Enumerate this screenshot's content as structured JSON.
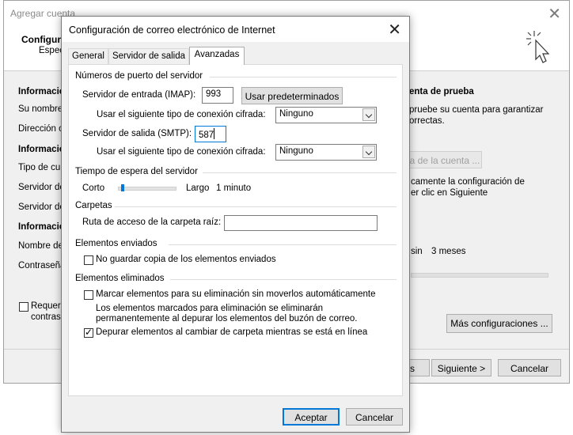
{
  "background_window": {
    "title": "Agregar cuenta",
    "header_title": "Configura",
    "header_subtitle": "Espec",
    "left_labels": [
      {
        "text": "Informació",
        "bold": true
      },
      {
        "text": "Su nombre",
        "bold": false
      },
      {
        "text": "Dirección c",
        "bold": false
      },
      {
        "text": "Informació",
        "bold": true
      },
      {
        "text": "Tipo de cu",
        "bold": false
      },
      {
        "text": "Servidor de",
        "bold": false
      },
      {
        "text": "Servidor de",
        "bold": false
      },
      {
        "text": "Informació",
        "bold": true
      },
      {
        "text": "Nombre de",
        "bold": false
      },
      {
        "text": "Contraseña",
        "bold": false
      }
    ],
    "require_line1": "Requeri",
    "require_line2": "contras",
    "test_title": "enta de prueba",
    "test_desc_line1": "pruebe su cuenta para garantizar",
    "test_desc_line2": "orrectas.",
    "test_button": "a de la cuenta ...",
    "auto_line1": "camente la configuración de",
    "auto_line2": "er clic en Siguiente",
    "offline_sin": "sin",
    "offline_value": "3 meses",
    "more_settings": "Más configuraciones ...",
    "back_button": "s",
    "next_button": "Siguiente >",
    "cancel_button": "Cancelar"
  },
  "dialog": {
    "title": "Configuración de correo electrónico de Internet",
    "tabs": [
      "General",
      "Servidor de salida",
      "Avanzadas"
    ],
    "active_tab": 2,
    "ports": {
      "group": "Números de puerto del servidor",
      "imap_label": "Servidor de entrada (IMAP):",
      "imap_value": "993",
      "defaults_button": "Usar predeterminados",
      "enc_label_in": "Usar el siguiente tipo de conexión cifrada:",
      "enc_value_in": "Ninguno",
      "smtp_label": "Servidor de salida (SMTP):",
      "smtp_value": "587",
      "enc_label_out": "Usar el siguiente tipo de conexión cifrada:",
      "enc_value_out": "Ninguno"
    },
    "timeout": {
      "group": "Tiempo de espera del servidor",
      "short": "Corto",
      "long": "Largo",
      "value": "1 minuto",
      "slider_level": 0.05
    },
    "folders": {
      "group": "Carpetas",
      "root_label": "Ruta de acceso de la carpeta raíz:",
      "root_value": ""
    },
    "sent": {
      "group": "Elementos enviados",
      "no_copy": "No guardar copia de los elementos enviados",
      "no_copy_checked": false
    },
    "deleted": {
      "group": "Elementos eliminados",
      "mark": "Marcar elementos para su eliminación sin moverlos automáticamente",
      "mark_checked": false,
      "note_line1": "Los elementos marcados para eliminación se eliminarán",
      "note_line2": "permanentemente al depurar los elementos del buzón de correo.",
      "purge": "Depurar elementos al cambiar de carpeta mientras se está en línea",
      "purge_checked": true
    },
    "accept_button": "Aceptar",
    "cancel_button": "Cancelar"
  }
}
